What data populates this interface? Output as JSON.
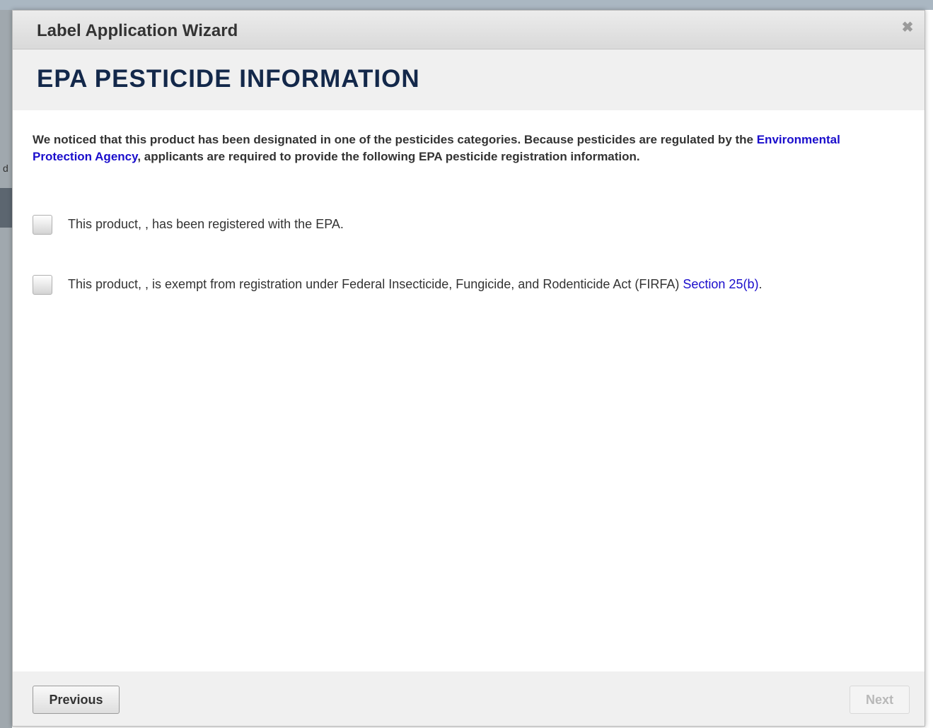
{
  "dialog": {
    "title": "Label Application Wizard",
    "close_symbol": "✖"
  },
  "section": {
    "heading": "EPA PESTICIDE INFORMATION"
  },
  "intro": {
    "text_before": "We noticed that this product has been designated in one of the pesticides categories. Because pesticides are regulated by the ",
    "link_text": "Environmental Protection Agency",
    "text_after": ", applicants are required to provide the following EPA pesticide registration information."
  },
  "options": [
    {
      "label": "This product, , has been registered with the EPA.",
      "checked": false
    },
    {
      "label": "This product, , is exempt from registration under Federal Insecticide, Fungicide, and Rodenticide Act (FIRFA) ",
      "link_text": "Section 25(b)",
      "label_end": ".",
      "checked": false
    }
  ],
  "footer": {
    "previous_label": "Previous",
    "next_label": "Next",
    "next_enabled": false
  },
  "background": {
    "partial_letter": "d"
  },
  "colors": {
    "heading": "#13284a",
    "link": "#1a0dcc",
    "text": "#333333"
  }
}
